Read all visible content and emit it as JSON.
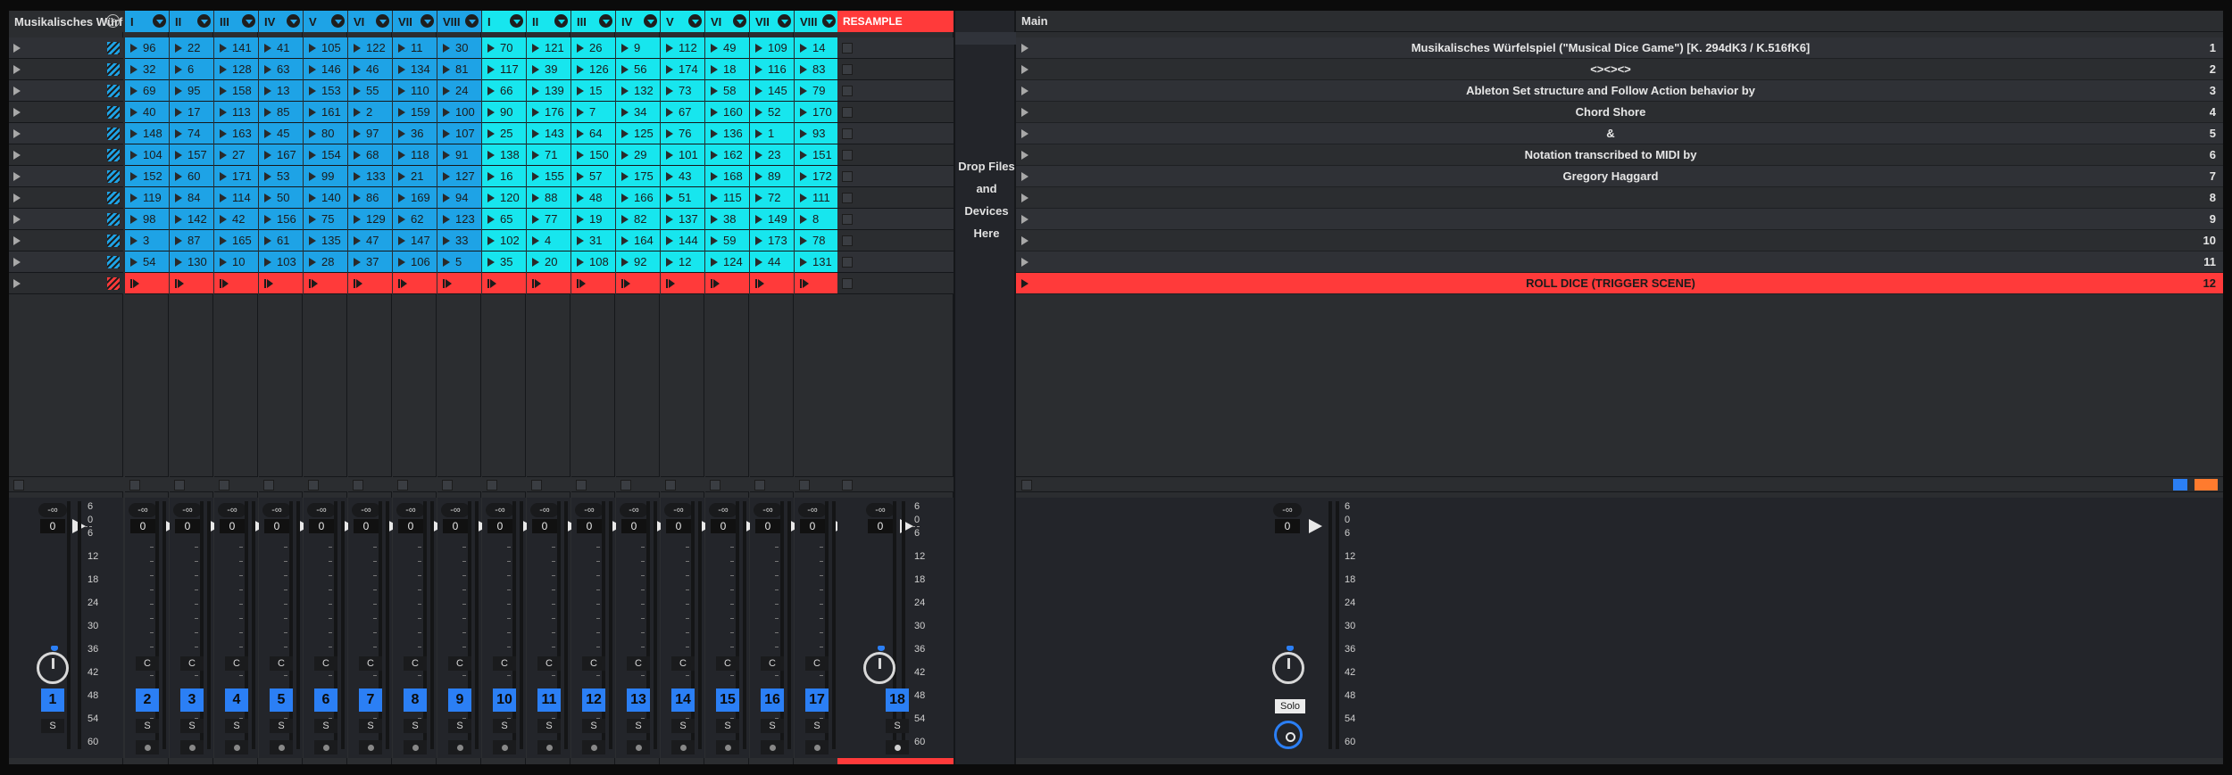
{
  "tracks": [
    {
      "name": "Musikalisches Würfelspiel",
      "kind": "group",
      "number": "1",
      "arm": "S",
      "icon": "group-fold-icon"
    },
    {
      "name": "I",
      "kind": "blue",
      "number": "2",
      "values": [
        "96",
        "32",
        "69",
        "40",
        "148",
        "104",
        "152",
        "119",
        "98",
        "3",
        "54"
      ]
    },
    {
      "name": "II",
      "kind": "blue",
      "number": "3",
      "values": [
        "22",
        "6",
        "95",
        "17",
        "74",
        "157",
        "60",
        "84",
        "142",
        "87",
        "130"
      ]
    },
    {
      "name": "III",
      "kind": "blue",
      "number": "4",
      "values": [
        "141",
        "128",
        "158",
        "113",
        "163",
        "27",
        "171",
        "114",
        "42",
        "165",
        "10"
      ]
    },
    {
      "name": "IV",
      "kind": "blue",
      "number": "5",
      "values": [
        "41",
        "63",
        "13",
        "85",
        "45",
        "167",
        "53",
        "50",
        "156",
        "61",
        "103"
      ]
    },
    {
      "name": "V",
      "kind": "blue",
      "number": "6",
      "values": [
        "105",
        "146",
        "153",
        "161",
        "80",
        "154",
        "99",
        "140",
        "75",
        "135",
        "28"
      ]
    },
    {
      "name": "VI",
      "kind": "blue",
      "number": "7",
      "values": [
        "122",
        "46",
        "55",
        "2",
        "97",
        "68",
        "133",
        "86",
        "129",
        "47",
        "37"
      ]
    },
    {
      "name": "VII",
      "kind": "blue",
      "number": "8",
      "values": [
        "11",
        "134",
        "110",
        "159",
        "36",
        "118",
        "21",
        "169",
        "62",
        "147",
        "106"
      ]
    },
    {
      "name": "VIII",
      "kind": "blue",
      "number": "9",
      "values": [
        "30",
        "81",
        "24",
        "100",
        "107",
        "91",
        "127",
        "94",
        "123",
        "33",
        "5"
      ]
    },
    {
      "name": "I",
      "kind": "cyan",
      "number": "10",
      "values": [
        "70",
        "117",
        "66",
        "90",
        "25",
        "138",
        "16",
        "120",
        "65",
        "102",
        "35"
      ]
    },
    {
      "name": "II",
      "kind": "cyan",
      "number": "11",
      "values": [
        "121",
        "39",
        "139",
        "176",
        "143",
        "71",
        "155",
        "88",
        "77",
        "4",
        "20"
      ]
    },
    {
      "name": "III",
      "kind": "cyan",
      "number": "12",
      "values": [
        "26",
        "126",
        "15",
        "7",
        "64",
        "150",
        "57",
        "48",
        "19",
        "31",
        "108"
      ]
    },
    {
      "name": "IV",
      "kind": "cyan",
      "number": "13",
      "values": [
        "9",
        "56",
        "132",
        "34",
        "125",
        "29",
        "175",
        "166",
        "82",
        "164",
        "92"
      ]
    },
    {
      "name": "V",
      "kind": "cyan",
      "number": "14",
      "values": [
        "112",
        "174",
        "73",
        "67",
        "76",
        "101",
        "43",
        "51",
        "137",
        "144",
        "12"
      ]
    },
    {
      "name": "VI",
      "kind": "cyan",
      "number": "15",
      "values": [
        "49",
        "18",
        "58",
        "160",
        "136",
        "162",
        "168",
        "115",
        "38",
        "59",
        "124"
      ]
    },
    {
      "name": "VII",
      "kind": "cyan",
      "number": "16",
      "values": [
        "109",
        "116",
        "145",
        "52",
        "1",
        "23",
        "89",
        "72",
        "149",
        "173",
        "44"
      ]
    },
    {
      "name": "VIII",
      "kind": "cyan",
      "number": "17",
      "values": [
        "14",
        "83",
        "79",
        "170",
        "93",
        "151",
        "172",
        "111",
        "8",
        "78",
        "131"
      ]
    },
    {
      "name": "RESAMPLE",
      "kind": "resample",
      "number": "18"
    }
  ],
  "mixer": {
    "volume_inf": "-∞",
    "volume_val": "0",
    "monitor_label": "C",
    "solo_label": "S",
    "db_scale": [
      "6",
      "0",
      "6",
      "12",
      "18",
      "24",
      "30",
      "36",
      "42",
      "48",
      "54",
      "60"
    ]
  },
  "drop_zone": {
    "line1": "Drop Files and",
    "line2": "Devices Here"
  },
  "main": {
    "title": "Main",
    "solo_label": "Solo",
    "scenes": [
      {
        "name": "Musikalisches Würfelspiel (\"Musical Dice Game\") [K. 294dK3 / K.516fK6]",
        "number": "1"
      },
      {
        "name": "<><><>",
        "number": "2"
      },
      {
        "name": "Ableton Set structure and Follow Action behavior by",
        "number": "3"
      },
      {
        "name": "Chord Shore",
        "number": "4"
      },
      {
        "name": "&",
        "number": "5"
      },
      {
        "name": "Notation transcribed to MIDI by",
        "number": "6"
      },
      {
        "name": "Gregory Haggard",
        "number": "7"
      },
      {
        "name": "",
        "number": "8"
      },
      {
        "name": "",
        "number": "9"
      },
      {
        "name": "",
        "number": "10"
      },
      {
        "name": "",
        "number": "11"
      },
      {
        "name": "ROLL DICE (TRIGGER SCENE)",
        "number": "12"
      }
    ]
  },
  "colors": {
    "blue_clip": "#1ea3e6",
    "cyan_clip": "#17e6ee",
    "red": "#ff3a3a",
    "track_button": "#2b7ff5",
    "orange": "#ff7b2e"
  }
}
